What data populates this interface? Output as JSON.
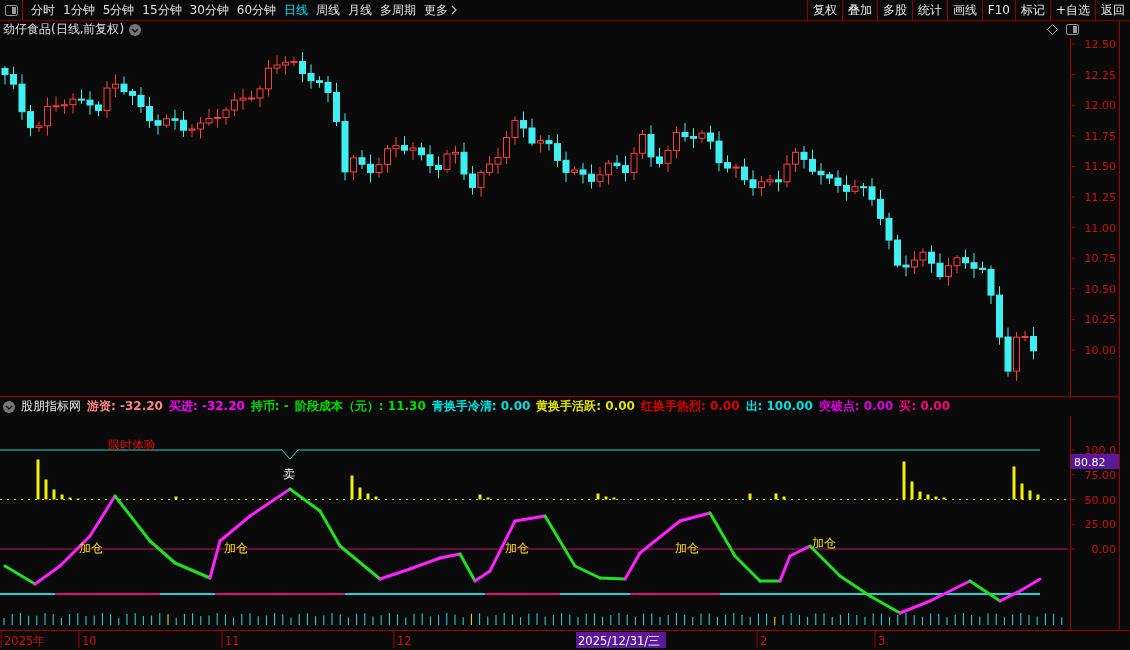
{
  "toolbar": {
    "periods": [
      {
        "label": "分时",
        "selected": false
      },
      {
        "label": "1分钟",
        "selected": false
      },
      {
        "label": "5分钟",
        "selected": false
      },
      {
        "label": "15分钟",
        "selected": false
      },
      {
        "label": "30分钟",
        "selected": false
      },
      {
        "label": "60分钟",
        "selected": false
      },
      {
        "label": "日线",
        "selected": true
      },
      {
        "label": "周线",
        "selected": false
      },
      {
        "label": "月线",
        "selected": false
      },
      {
        "label": "多周期",
        "selected": false
      },
      {
        "label": "更多",
        "selected": false
      }
    ],
    "actions": [
      "复权",
      "叠加",
      "多股",
      "统计",
      "画线",
      "F10",
      "标记",
      "+自选",
      "返回"
    ]
  },
  "chart": {
    "title": "劲仔食品(日线,前复权)",
    "price_ticks": [
      "12.50",
      "12.25",
      "12.00",
      "11.75",
      "11.50",
      "11.25",
      "11.00",
      "10.75",
      "10.50",
      "10.25",
      "10.00"
    ]
  },
  "indicator": {
    "name": "股朋指标网",
    "legend": [
      {
        "text": "游资: -32.20",
        "color": "#ff8080"
      },
      {
        "text": "买进: -32.20",
        "color": "#ff00ff"
      },
      {
        "text": "持币: -",
        "color": "#00e000"
      },
      {
        "text": "阶段成本（元）: 11.30",
        "color": "#00e000"
      },
      {
        "text": "青换手冷清: 0.00",
        "color": "#00e0e0"
      },
      {
        "text": "黄换手活跃: 0.00",
        "color": "#e0e000"
      },
      {
        "text": "红换手热烈: 0.00",
        "color": "#e00000"
      },
      {
        "text": "出: 100.00",
        "color": "#00e0e0"
      },
      {
        "text": "突破点: 0.00",
        "color": "#e000e0"
      },
      {
        "text": "买: 0.00",
        "color": "#ff0080"
      }
    ],
    "ticks": [
      "100.0",
      "75.00",
      "50.00",
      "25.00",
      "0.00"
    ],
    "current_value": "80.82",
    "annotations": [
      {
        "kind": "promo",
        "text": "限时体验"
      },
      {
        "kind": "sell",
        "text": "卖"
      },
      {
        "kind": "add",
        "text": "加仓"
      },
      {
        "kind": "add",
        "text": "加仓"
      },
      {
        "kind": "add",
        "text": "加仓"
      },
      {
        "kind": "add",
        "text": "加仓"
      },
      {
        "kind": "add",
        "text": "加仓"
      }
    ]
  },
  "date_axis": {
    "labels": [
      {
        "text": "2025年",
        "selected": false
      },
      {
        "text": "10",
        "selected": false
      },
      {
        "text": "11",
        "selected": false
      },
      {
        "text": "12",
        "selected": false
      },
      {
        "text": "2025/12/31/三",
        "selected": true
      },
      {
        "text": "2",
        "selected": false
      },
      {
        "text": "3",
        "selected": false
      }
    ]
  }
}
